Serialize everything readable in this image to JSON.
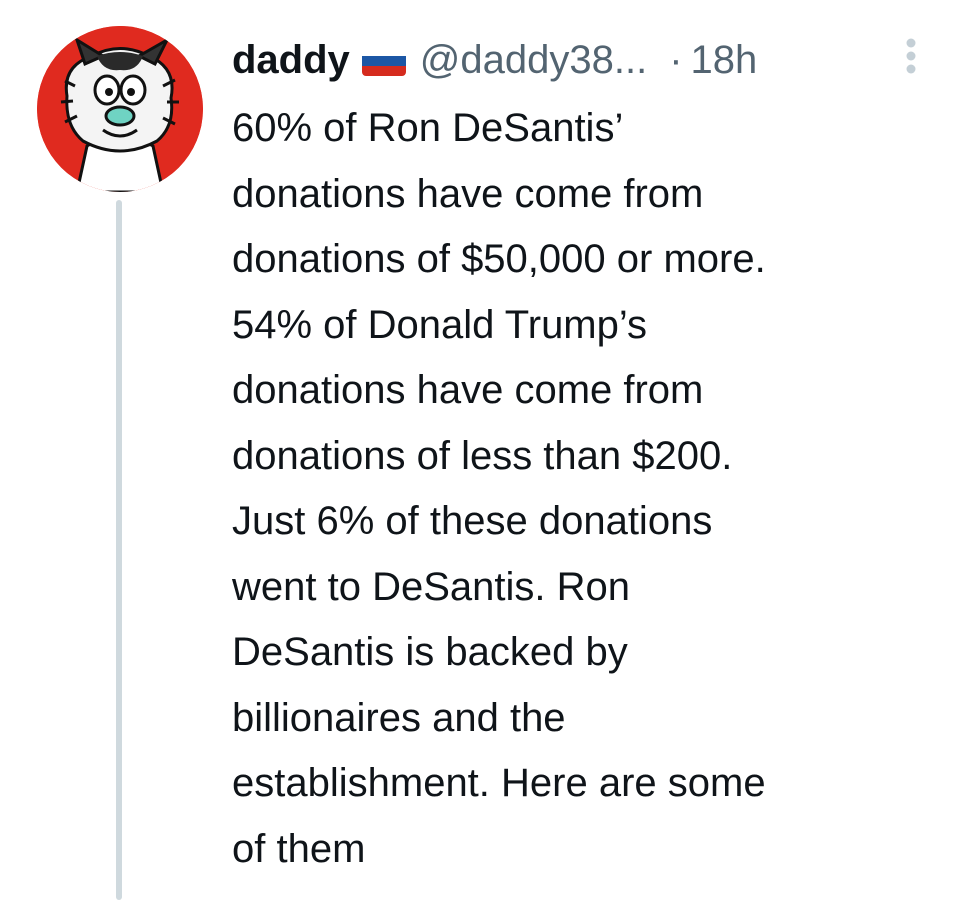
{
  "tweet": {
    "display_name": "daddy",
    "flag_icon": "russian-flag-icon",
    "handle": "@daddy38...",
    "separator": "·",
    "time": "18h",
    "more_icon": "vertical-ellipsis-icon",
    "text_lines": [
      "60% of Ron DeSantis’",
      "donations have come from",
      "donations of $50,000 or more.",
      "54% of Donald Trump’s",
      "donations have come from",
      "donations of less than $200.",
      "Just 6% of these donations",
      "went to DeSantis. Ron",
      "DeSantis is backed by",
      "billionaires and the",
      "establishment. Here are some",
      "of them"
    ]
  },
  "colors": {
    "avatar_bg": "#e02a1f",
    "text_primary": "#0f1419",
    "text_secondary": "#536471",
    "thread_line": "#cfd9de",
    "flag_white": "#ffffff",
    "flag_blue": "#1c57a5",
    "flag_red": "#d52b1e"
  }
}
